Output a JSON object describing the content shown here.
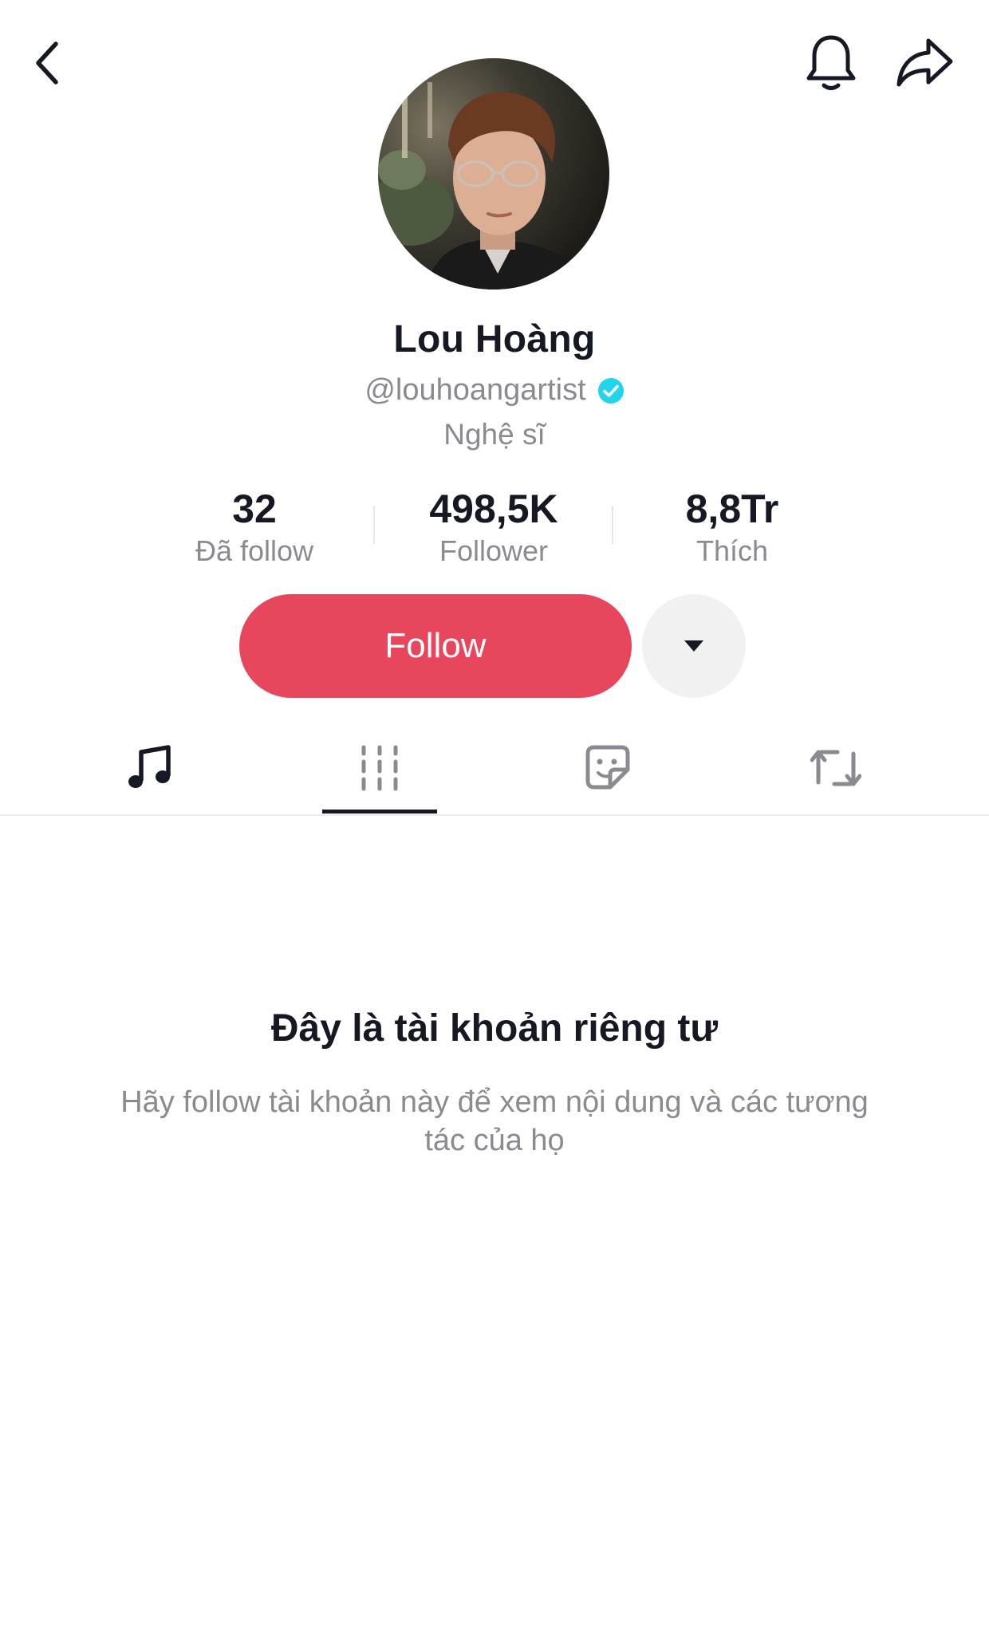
{
  "header": {
    "back_icon": "chevron-left-icon",
    "notification_icon": "bell-icon",
    "share_icon": "share-arrow-icon"
  },
  "profile": {
    "name": "Lou Hoàng",
    "handle": "@louhoangartist",
    "verified": true,
    "verified_color": "#20d5ec",
    "bio": "Nghệ sĩ"
  },
  "stats": {
    "following": {
      "value": "32",
      "label": "Đã follow"
    },
    "followers": {
      "value": "498,5K",
      "label": "Follower"
    },
    "likes": {
      "value": "8,8Tr",
      "label": "Thích"
    }
  },
  "actions": {
    "follow_label": "Follow",
    "follow_color": "#e8465d",
    "more_icon": "caret-down-icon"
  },
  "tabs": [
    {
      "name": "music",
      "icon": "music-note-icon",
      "active": false
    },
    {
      "name": "videos",
      "icon": "grid-lines-icon",
      "active": true
    },
    {
      "name": "stickers",
      "icon": "sticker-icon",
      "active": false
    },
    {
      "name": "reposts",
      "icon": "repost-icon",
      "active": false
    }
  ],
  "private_notice": {
    "title": "Đây là tài khoản riêng tư",
    "subtitle": "Hãy follow tài khoản này để xem nội dung và các tương tác của họ"
  }
}
